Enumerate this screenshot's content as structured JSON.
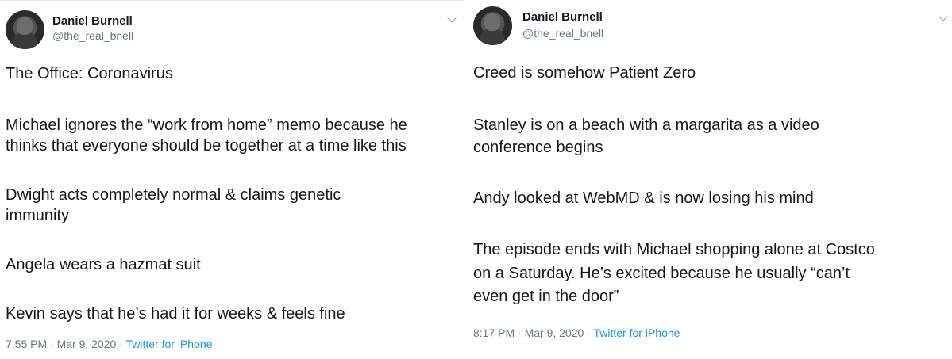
{
  "tweets": [
    {
      "author_name": "Daniel Burnell",
      "handle": "@the_real_bnell",
      "lines": [
        "The Office: Coronavirus",
        "Michael ignores the “work from home” memo because he",
        "thinks that everyone should be together at a time like this",
        "Dwight acts completely normal & claims genetic",
        "immunity",
        "Angela wears a hazmat suit",
        "Kevin says that he’s had it for weeks & feels fine"
      ],
      "time": "7:55 PM · Mar 9, 2020 · ",
      "source": "Twitter for iPhone"
    },
    {
      "author_name": "Daniel Burnell",
      "handle": "@the_real_bnell",
      "lines": [
        "Creed is somehow Patient Zero",
        "Stanley is on a beach with a margarita as a video",
        "conference begins",
        "Andy looked at WebMD & is now losing his mind",
        "The episode ends with Michael shopping alone at Costco",
        "on a Saturday. He’s excited because he usually “can’t",
        "even get in the door”"
      ],
      "time": "8:17 PM · Mar 9, 2020 · ",
      "source": "Twitter for iPhone"
    }
  ]
}
